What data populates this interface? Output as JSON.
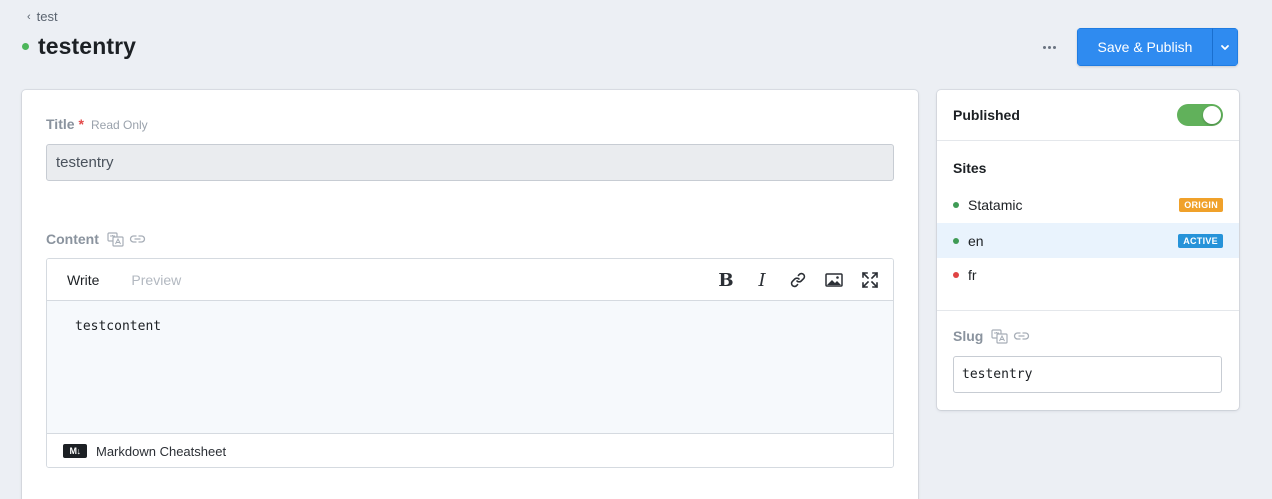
{
  "breadcrumb": {
    "label": "test"
  },
  "header": {
    "title": "testentry",
    "status_color": "#4cb65a"
  },
  "actions": {
    "save_publish_label": "Save & Publish",
    "accent": "#2f8bf0"
  },
  "fields": {
    "title": {
      "label": "Title",
      "required_marker": "*",
      "readonly_label": "Read Only",
      "value": "testentry"
    },
    "content": {
      "label": "Content",
      "tabs": {
        "write": "Write",
        "preview": "Preview"
      },
      "tools": [
        "bold-icon",
        "italic-icon",
        "link-icon",
        "image-icon",
        "fullscreen-icon"
      ],
      "value": "testcontent",
      "footer_label": "Markdown Cheatsheet",
      "logo_text": "M↓"
    }
  },
  "sidebar": {
    "published_label": "Published",
    "published": true,
    "sites_title": "Sites",
    "sites": [
      {
        "name": "Statamic",
        "badge": "ORIGIN",
        "badge_color": "#f0a12a",
        "dot_color": "#3f9b55",
        "active": false
      },
      {
        "name": "en",
        "badge": "ACTIVE",
        "badge_color": "#2693d9",
        "dot_color": "#3f9b55",
        "active": true
      },
      {
        "name": "fr",
        "badge": "",
        "badge_color": "",
        "dot_color": "#e04343",
        "active": false
      }
    ],
    "slug": {
      "label": "Slug",
      "value": "testentry"
    }
  }
}
